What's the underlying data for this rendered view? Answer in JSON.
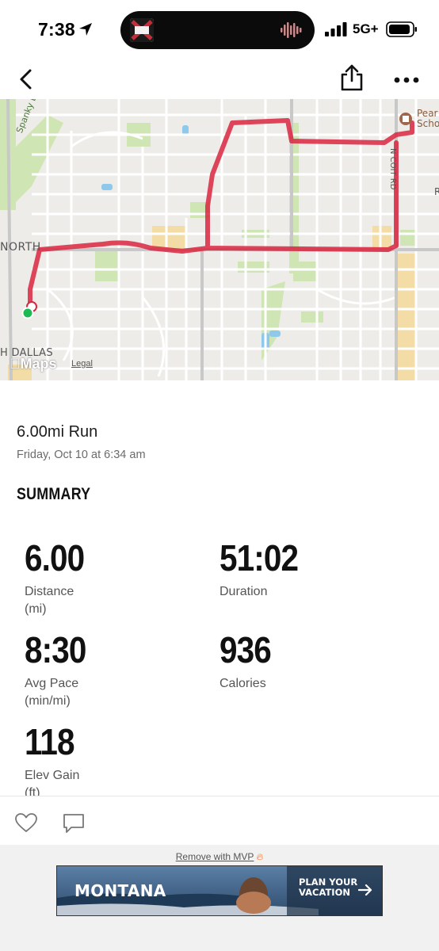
{
  "status_bar": {
    "time": "7:38",
    "network": "5G+",
    "icons": [
      "location-arrow-icon",
      "signal-bars-icon",
      "battery-icon"
    ]
  },
  "nav": {
    "icons": [
      "chevron-left-icon",
      "share-icon",
      "more-dots-icon"
    ]
  },
  "map": {
    "labels": {
      "north": "NORTH",
      "dallas": "H DALLAS",
      "spanky": "Spanky Branch",
      "road": "N COIT RD",
      "poi": "Pear\nScho",
      "r": "R"
    },
    "brand": "Maps",
    "legal": "Legal",
    "route_color": "#d9263f",
    "start_color": "#1db954"
  },
  "activity": {
    "title": "6.00mi Run",
    "date": "Friday, Oct 10 at 6:34 am"
  },
  "summary": {
    "heading": "SUMMARY",
    "stats": [
      {
        "value": "6.00",
        "label": "Distance\n(mi)"
      },
      {
        "value": "51:02",
        "label": "Duration"
      },
      {
        "value": "8:30",
        "label": "Avg Pace\n(min/mi)"
      },
      {
        "value": "936",
        "label": "Calories"
      },
      {
        "value": "118",
        "label": "Elev Gain\n(ft)"
      }
    ]
  },
  "actions": {
    "icons": [
      "heart-icon",
      "comment-icon"
    ]
  },
  "ad": {
    "remove_text": "Remove with MVP",
    "brand": "MONTANA",
    "cta": "PLAN YOUR\nVACATION"
  }
}
